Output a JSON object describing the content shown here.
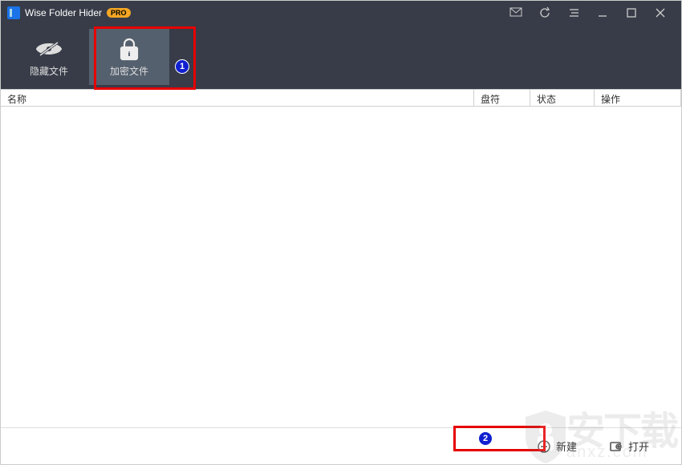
{
  "app": {
    "title": "Wise Folder Hider",
    "pro_badge": "PRO"
  },
  "tabs": {
    "hide": "隐藏文件",
    "encrypt": "加密文件"
  },
  "columns": {
    "name": "名称",
    "drive": "盘符",
    "status": "状态",
    "ops": "操作"
  },
  "footer": {
    "new": "新建",
    "open": "打开"
  },
  "annotations": {
    "one": "1",
    "two": "2"
  },
  "watermark": {
    "text": "安下载",
    "domain": "anxz.com"
  }
}
